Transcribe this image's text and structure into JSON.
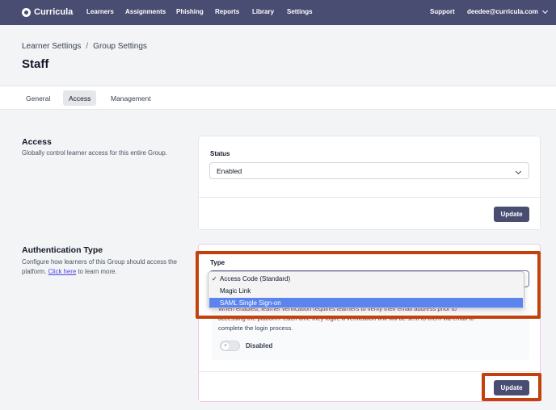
{
  "nav": {
    "brand": "Curricula",
    "items": [
      "Learners",
      "Assignments",
      "Phishing",
      "Reports",
      "Library",
      "Settings"
    ],
    "support": "Support",
    "user_email": "deedee@curricula.com"
  },
  "breadcrumb": {
    "parent": "Learner Settings",
    "separator": "/",
    "current": "Group Settings"
  },
  "page_title": "Staff",
  "tabs": [
    "General",
    "Access",
    "Management"
  ],
  "access": {
    "title": "Access",
    "description": "Globally control learner access for this entire Group.",
    "status_label": "Status",
    "status_value": "Enabled",
    "update_label": "Update"
  },
  "auth": {
    "title": "Authentication Type",
    "description_prefix": "Configure how learners of this Group should access the platform. ",
    "description_link": "Click here",
    "description_suffix": " to learn more.",
    "type_label": "Type",
    "options": [
      "Access Code (Standard)",
      "Magic Link",
      "SAML Single Sign-on"
    ],
    "selected_option": "Access Code (Standard)",
    "highlighted_option": "SAML Single Sign-on",
    "hint_line1": "When enabled, learner verification requires learners to verify their email address prior to",
    "hint_line2": "accessing the platform. Each time they login, a verification link will be sent to them via email to",
    "hint_line3": "complete the login process.",
    "toggle_label": "Disabled",
    "toggle_state": false,
    "update_label": "Update"
  },
  "colors": {
    "nav_bg": "#4a4d72",
    "button_bg": "#4a4d72",
    "highlight": "#5b84ef",
    "annotation": "#c2410c"
  }
}
